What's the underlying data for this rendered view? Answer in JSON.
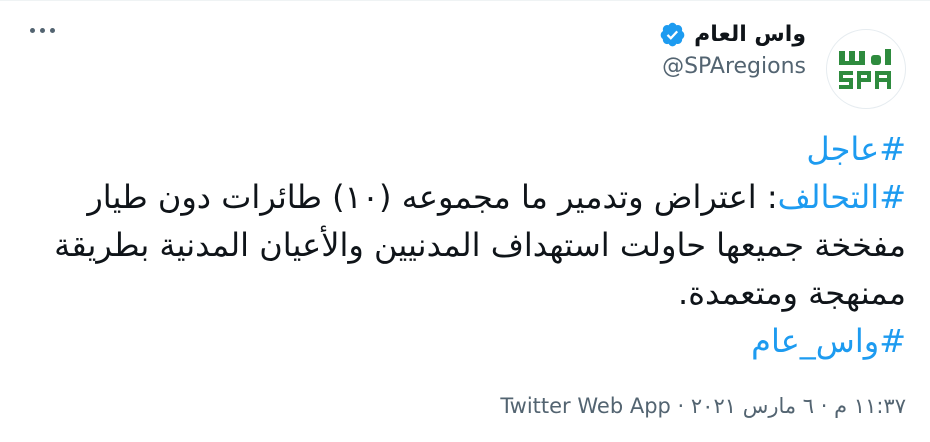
{
  "header": {
    "display_name": "واس العام",
    "handle": "@SPAregions",
    "more_label": "More",
    "avatar_logo_text": "SPA",
    "colors": {
      "verified": "#1d9bf0",
      "logo": "#2e8b3e"
    }
  },
  "tweet": {
    "hashtag1": "#عاجل",
    "hashtag2": "#التحالف",
    "text_main": ": اعتراض وتدمير ما مجموعه (١٠) طائرات دون طيار مفخخة جميعها حاولت استهداف المدنيين والأعيان المدنية بطريقة ممنهجة ومتعمدة.",
    "hashtag3": "#واس_عام",
    "hashtag_color": "#1d9bf0"
  },
  "meta": {
    "time": "١١:٣٧ م",
    "separator1": " · ",
    "date": "٦ مارس ٢٠٢١",
    "separator2": " · ",
    "source": "Twitter Web App"
  }
}
